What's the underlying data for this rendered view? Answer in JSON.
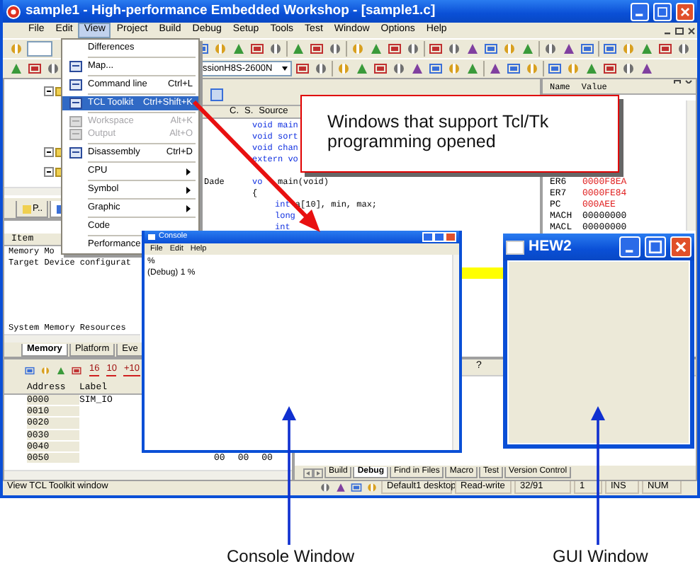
{
  "window": {
    "title": "sample1 - High-performance Embedded Workshop - [sample1.c]"
  },
  "menu_bar": [
    {
      "label": "File",
      "selected": false
    },
    {
      "label": "Edit",
      "selected": false
    },
    {
      "label": "View",
      "selected": true
    },
    {
      "label": "Project",
      "selected": false
    },
    {
      "label": "Build",
      "selected": false
    },
    {
      "label": "Debug",
      "selected": false
    },
    {
      "label": "Setup",
      "selected": false
    },
    {
      "label": "Tools",
      "selected": false
    },
    {
      "label": "Test",
      "selected": false
    },
    {
      "label": "Window",
      "selected": false
    },
    {
      "label": "Options",
      "selected": false
    },
    {
      "label": "Help",
      "selected": false
    }
  ],
  "toolbar": {
    "session": "ssionH8S-2600N"
  },
  "view_menu": [
    {
      "kind": "item",
      "label": "Differences",
      "has_icon": false,
      "disabled": false,
      "selected": false
    },
    {
      "kind": "separator"
    },
    {
      "kind": "item",
      "label": "Map...",
      "has_icon": true,
      "disabled": false,
      "selected": false
    },
    {
      "kind": "separator"
    },
    {
      "kind": "item",
      "label": "Command line",
      "shortcut": "Ctrl+L",
      "has_icon": true,
      "disabled": false,
      "selected": false
    },
    {
      "kind": "separator"
    },
    {
      "kind": "item",
      "label": "TCL Toolkit",
      "shortcut": "Ctrl+Shift+K",
      "has_icon": true,
      "disabled": false,
      "selected": true
    },
    {
      "kind": "separator"
    },
    {
      "kind": "item",
      "label": "Workspace",
      "shortcut": "Alt+K",
      "has_icon": true,
      "disabled": true,
      "selected": false
    },
    {
      "kind": "item",
      "label": "Output",
      "shortcut": "Alt+O",
      "has_icon": true,
      "disabled": true,
      "selected": false
    },
    {
      "kind": "separator"
    },
    {
      "kind": "item",
      "label": "Disassembly",
      "shortcut": "Ctrl+D",
      "has_icon": true,
      "disabled": false,
      "selected": false
    },
    {
      "kind": "separator"
    },
    {
      "kind": "submenu",
      "label": "CPU",
      "has_icon": false,
      "disabled": false,
      "selected": false
    },
    {
      "kind": "separator"
    },
    {
      "kind": "submenu",
      "label": "Symbol",
      "has_icon": false,
      "disabled": false,
      "selected": false
    },
    {
      "kind": "separator"
    },
    {
      "kind": "submenu",
      "label": "Graphic",
      "has_icon": false,
      "disabled": false,
      "selected": false
    },
    {
      "kind": "separator"
    },
    {
      "kind": "item",
      "label": "Code",
      "has_icon": false,
      "disabled": false,
      "selected": false
    },
    {
      "kind": "separator"
    },
    {
      "kind": "item",
      "label": "Performance",
      "has_icon": false,
      "disabled": false,
      "selected": false
    }
  ],
  "workspace": {
    "tree": [
      {
        "expanded": true
      },
      {
        "expanded": true
      },
      {
        "expanded": true
      }
    ],
    "tabs": [
      {
        "label": "P..",
        "selected": false
      },
      {
        "selected": true
      }
    ]
  },
  "source": {
    "columns": [
      "C.",
      "S.",
      "Source"
    ],
    "lines": [
      {
        "kind": "code",
        "tokens": [
          {
            "text": "void main",
            "keyword": true
          }
        ]
      },
      {
        "kind": "code",
        "tokens": [
          {
            "text": "void sort",
            "keyword": true
          }
        ]
      },
      {
        "kind": "code",
        "tokens": [
          {
            "text": "void chan",
            "keyword": true
          }
        ]
      },
      {
        "kind": "code",
        "tokens": [
          {
            "text": "extern vo",
            "keyword": true
          }
        ]
      },
      {
        "kind": "blank"
      },
      {
        "kind": "code",
        "address": "Dade",
        "tokens": [
          {
            "text": "vo",
            "keyword": true
          },
          {
            "text": "   main(void)",
            "keyword": false
          }
        ]
      },
      {
        "kind": "code",
        "tokens": [
          {
            "text": "{",
            "keyword": false
          }
        ]
      },
      {
        "kind": "code",
        "indented": true,
        "tokens": [
          {
            "text": "int",
            "keyword": true
          },
          {
            "text": " a[10], min, max;",
            "keyword": false
          }
        ]
      },
      {
        "kind": "code",
        "indented": true,
        "tokens": [
          {
            "text": "long",
            "keyword": true
          }
        ]
      },
      {
        "kind": "code",
        "indented": true,
        "tokens": [
          {
            "text": "int",
            "keyword": true
          }
        ]
      },
      {
        "kind": "blank"
      },
      {
        "kind": "blank"
      },
      {
        "kind": "blank"
      },
      {
        "kind": "code",
        "current": true
      }
    ]
  },
  "registers": {
    "columns": [
      "Name",
      "Value"
    ],
    "rows": [
      {
        "name": "ER6",
        "value": "0000F8EA",
        "changed": true
      },
      {
        "name": "ER7",
        "value": "0000FE84",
        "changed": true
      },
      {
        "name": "PC",
        "value": "000AEE",
        "changed": true
      },
      {
        "name": "MACH",
        "value": "00000000",
        "changed": false
      },
      {
        "name": "MACL",
        "value": "00000000",
        "changed": false
      }
    ]
  },
  "item_pane": {
    "header": "Item",
    "rows": [
      "Memory Mo",
      "Target Device configurat",
      "System Memory Resources"
    ],
    "tabs": [
      {
        "label": "Memory",
        "selected": true
      },
      {
        "label": "Platform",
        "selected": false
      },
      {
        "label": "Eve",
        "selected": false
      }
    ]
  },
  "memory": {
    "buttons": [
      "16",
      "10",
      "+10"
    ],
    "columns": [
      "Address",
      "Label"
    ],
    "rows": [
      {
        "address": "0000",
        "label": "SIM_IO"
      },
      {
        "address": "0010"
      },
      {
        "address": "0020"
      },
      {
        "address": "0030"
      },
      {
        "address": "0040"
      },
      {
        "address": "0050",
        "values": [
          "00",
          "00",
          "00"
        ]
      }
    ]
  },
  "output": {
    "help": "?",
    "tabs": [
      {
        "label": "Build",
        "selected": false
      },
      {
        "label": "Debug",
        "selected": true
      },
      {
        "label": "Find in Files",
        "selected": false
      },
      {
        "label": "Macro",
        "selected": false
      },
      {
        "label": "Test",
        "selected": false
      },
      {
        "label": "Version Control",
        "selected": false
      }
    ]
  },
  "status_bar": {
    "message": "View TCL Toolkit window",
    "fields": [
      "Default1 desktop",
      "Read-write",
      "32/91",
      "1",
      "INS",
      "NUM"
    ]
  },
  "console_window": {
    "title": "Console",
    "menu": [
      "File",
      "Edit",
      "Help"
    ],
    "lines": [
      "%",
      "(Debug) 1 %"
    ]
  },
  "gui_window": {
    "title": "HEW2"
  },
  "callout": {
    "text": "Windows that support Tcl/Tk programming opened"
  },
  "annotations": [
    {
      "label": "Console Window"
    },
    {
      "label": "GUI Window"
    }
  ]
}
